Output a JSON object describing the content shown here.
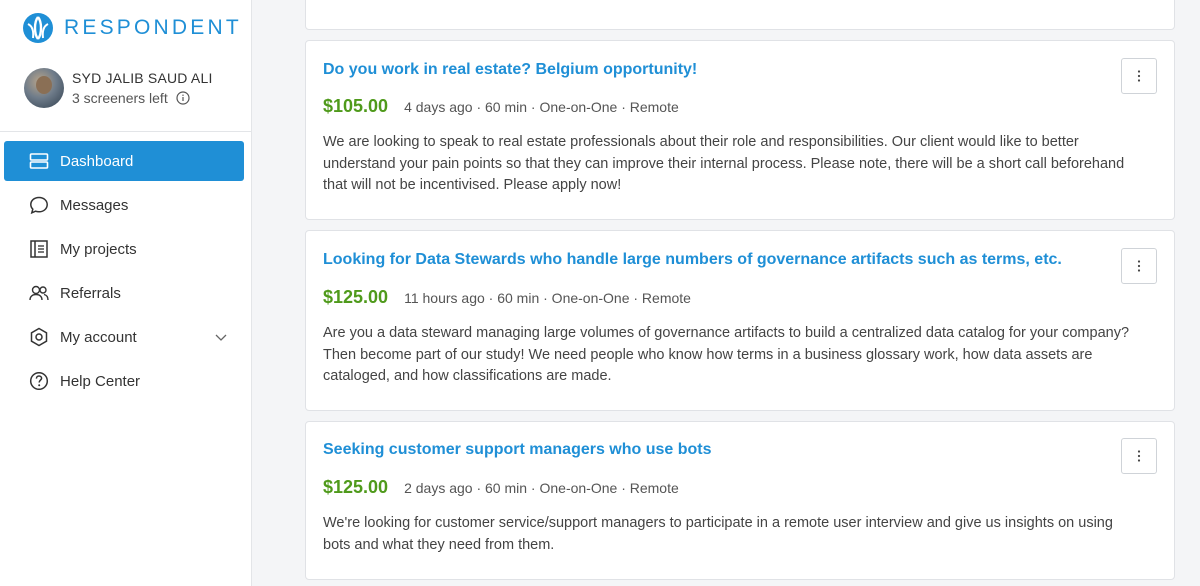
{
  "brand": {
    "name": "RESPONDENT",
    "color": "#1f8fd6"
  },
  "user": {
    "name": "SYD JALIB SAUD ALI",
    "screeners_left": "3 screeners left"
  },
  "nav": {
    "items": [
      {
        "label": "Dashboard",
        "icon": "dashboard-icon"
      },
      {
        "label": "Messages",
        "icon": "chat-bubble-icon"
      },
      {
        "label": "My projects",
        "icon": "projects-icon"
      },
      {
        "label": "Referrals",
        "icon": "people-icon"
      },
      {
        "label": "My account",
        "icon": "hexagon-gear-icon"
      },
      {
        "label": "Help Center",
        "icon": "question-circle-icon"
      }
    ],
    "active": "Dashboard"
  },
  "projects": [
    {
      "title": "Do you work in real estate? Belgium opportunity!",
      "price": "$105.00",
      "meta": "4 days ago · 60 min · One-on-One · Remote",
      "description": "We are looking to speak to real estate professionals about their role and responsibilities. Our client would like to better understand your pain points so that they can improve their internal process. Please note, there will be a short call beforehand that will not be incentivised. Please apply now!"
    },
    {
      "title": "Looking for Data Stewards who handle large numbers of governance artifacts such as terms, etc.",
      "price": "$125.00",
      "meta": "11 hours ago · 60 min · One-on-One · Remote",
      "description": "Are you a data steward managing large volumes of governance artifacts to build a centralized data catalog for your company? Then become part of our study! We need people who know how terms in a business glossary work, how data assets are cataloged, and how classifications are made."
    },
    {
      "title": "Seeking customer support managers who use bots",
      "price": "$125.00",
      "meta": "2 days ago · 60 min · One-on-One · Remote",
      "description": "We're looking for customer service/support managers to participate in a remote user interview and give us insights on using bots and what they need from them."
    }
  ],
  "colors": {
    "accent": "#1f8fd6",
    "price": "#4f9a1b"
  }
}
